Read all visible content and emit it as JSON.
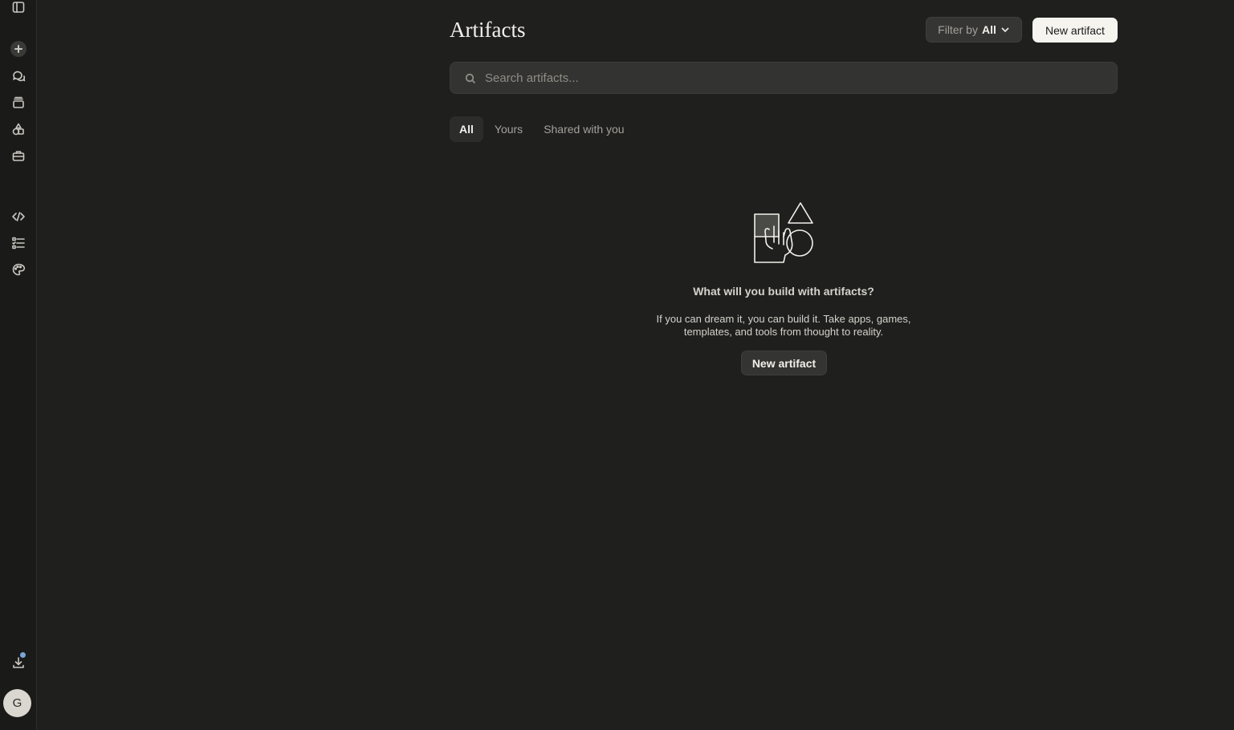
{
  "rail": {
    "items": [
      {
        "name": "sidebar-toggle-icon"
      },
      {
        "name": "new-chat-icon"
      },
      {
        "name": "chats-icon"
      },
      {
        "name": "projects-icon"
      },
      {
        "name": "artifacts-icon"
      },
      {
        "name": "toolbox-icon"
      },
      {
        "name": "code-icon"
      },
      {
        "name": "tasks-icon"
      },
      {
        "name": "palette-icon"
      },
      {
        "name": "download-icon"
      }
    ],
    "avatar_initial": "G"
  },
  "header": {
    "title": "Artifacts",
    "filter_label": "Filter by",
    "filter_value": "All",
    "new_artifact_label": "New artifact"
  },
  "search": {
    "placeholder": "Search artifacts...",
    "value": ""
  },
  "tabs": [
    {
      "label": "All",
      "active": true
    },
    {
      "label": "Yours",
      "active": false
    },
    {
      "label": "Shared with you",
      "active": false
    }
  ],
  "empty_state": {
    "title": "What will you build with artifacts?",
    "description": "If you can dream it, you can build it. Take apps, games, templates, and tools from thought to reality.",
    "button_label": "New artifact"
  }
}
